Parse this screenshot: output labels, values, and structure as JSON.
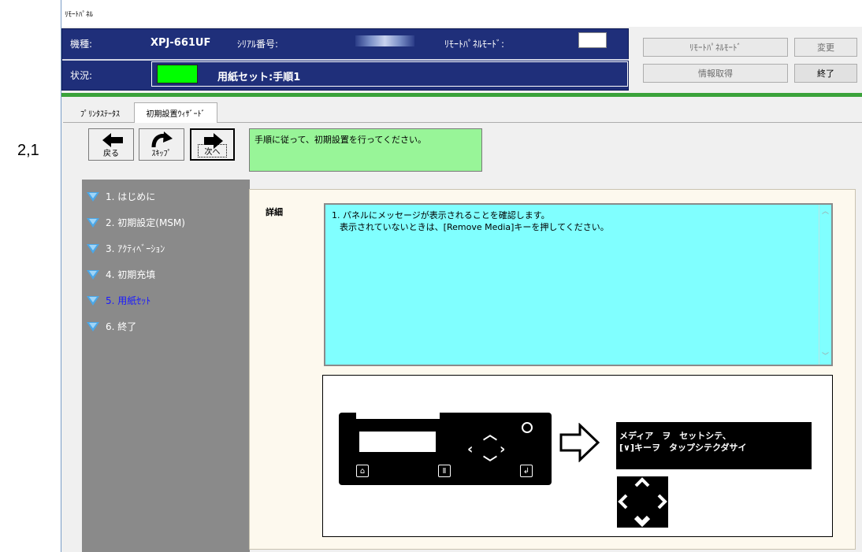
{
  "annotation": {
    "callout_label": "2,1"
  },
  "window": {
    "title": "ﾘﾓｰﾄﾊﾟﾈﾙ"
  },
  "header": {
    "model_label": "機種:",
    "model_value": "XPJ-661UF",
    "serial_label": "ｼﾘｱﾙ番号:",
    "remote_mode_label": "ﾘﾓｰﾄﾊﾟﾈﾙﾓｰﾄﾞ:",
    "status_label": "状況:",
    "status_text": "用紙セット:手順1",
    "status_color": "#00ff00",
    "buttons": {
      "remote_mode": "ﾘﾓｰﾄﾊﾟﾈﾙﾓｰﾄﾞ",
      "change": "変更",
      "get_info": "情報取得",
      "exit": "終了"
    }
  },
  "tabs": {
    "printer_status": "ﾌﾟﾘﾝﾀｽﾃｰﾀｽ",
    "initial_setup": "初期設置ｳｨｻﾞｰﾄﾞ"
  },
  "nav": {
    "back": "戻る",
    "skip": "ｽｷｯﾌﾟ",
    "next": "次へ"
  },
  "instruction": "手順に従って、初期設置を行ってください。",
  "steps": [
    {
      "label": "1. はじめに",
      "current": false
    },
    {
      "label": "2. 初期設定(MSM)",
      "current": false
    },
    {
      "label": "3. ｱｸﾃｨﾍﾞｰｼｮﾝ",
      "current": false
    },
    {
      "label": "4. 初期充填",
      "current": false
    },
    {
      "label": "5. 用紙ｾｯﾄ",
      "current": true
    },
    {
      "label": "6. 終了",
      "current": false
    }
  ],
  "detail": {
    "label": "詳細",
    "line1": "1. パネルにメッセージが表示されることを確認します。",
    "line2": "表示されていないときは、[Remove Media]キーを押してください。"
  },
  "panel_message": {
    "line1": "メディア　ヲ　セットシテ、",
    "line2": "[∨]キーヲ　タップシテクダサイ"
  },
  "colors": {
    "header_bg": "#1f2f7a",
    "instruction_bg": "#98f598",
    "detail_bg": "#80ffff",
    "accent_green": "#3aa23a"
  }
}
